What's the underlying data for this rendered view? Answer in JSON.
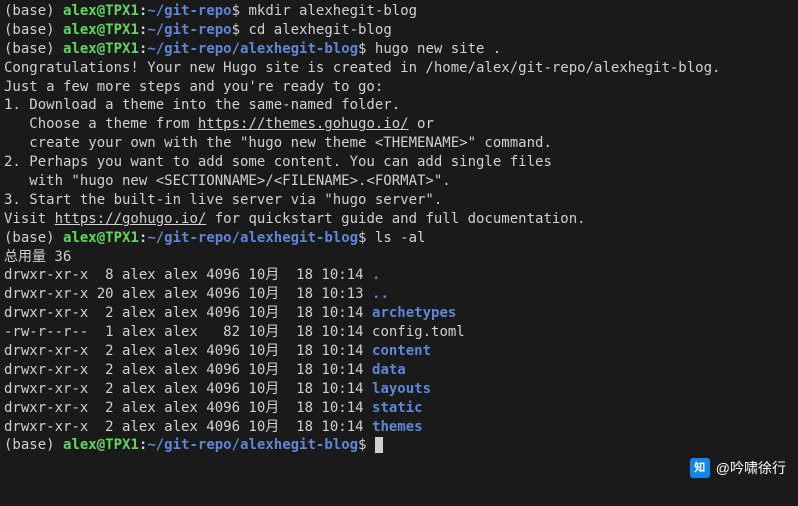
{
  "prompts": [
    {
      "env": "(base) ",
      "user": "alex",
      "at": "@",
      "host": "TPX1",
      "colon": ":",
      "path": "~/git-repo",
      "symbol": "$ ",
      "command": "mkdir alexhegit-blog"
    },
    {
      "env": "(base) ",
      "user": "alex",
      "at": "@",
      "host": "TPX1",
      "colon": ":",
      "path": "~/git-repo",
      "symbol": "$ ",
      "command": "cd alexhegit-blog"
    },
    {
      "env": "(base) ",
      "user": "alex",
      "at": "@",
      "host": "TPX1",
      "colon": ":",
      "path": "~/git-repo/alexhegit-blog",
      "symbol": "$ ",
      "command": "hugo new site ."
    }
  ],
  "congrats": "Congratulations! Your new Hugo site is created in /home/alex/git-repo/alexhegit-blog.",
  "blank1": "",
  "ready": "Just a few more steps and you're ready to go:",
  "blank2": "",
  "step1a": "1. Download a theme into the same-named folder.",
  "step1b_pre": "   Choose a theme from ",
  "step1b_link": "https://themes.gohugo.io/",
  "step1b_post": " or",
  "step1c": "   create your own with the \"hugo new theme <THEMENAME>\" command.",
  "step2a": "2. Perhaps you want to add some content. You can add single files",
  "step2b": "   with \"hugo new <SECTIONNAME>/<FILENAME>.<FORMAT>\".",
  "step3": "3. Start the built-in live server via \"hugo server\".",
  "blank3": "",
  "visit_pre": "Visit ",
  "visit_link": "https://gohugo.io/",
  "visit_post": " for quickstart guide and full documentation.",
  "prompt_ls": {
    "env": "(base) ",
    "user": "alex",
    "at": "@",
    "host": "TPX1",
    "colon": ":",
    "path": "~/git-repo/alexhegit-blog",
    "symbol": "$ ",
    "command": "ls -al"
  },
  "total": "总用量 36",
  "ls": [
    {
      "perms": "drwxr-xr-x  8 alex alex 4096 10月  18 10:14 ",
      "name": ".",
      "is_dir": true
    },
    {
      "perms": "drwxr-xr-x 20 alex alex 4096 10月  18 10:13 ",
      "name": "..",
      "is_dir": true
    },
    {
      "perms": "drwxr-xr-x  2 alex alex 4096 10月  18 10:14 ",
      "name": "archetypes",
      "is_dir": true
    },
    {
      "perms": "-rw-r--r--  1 alex alex   82 10月  18 10:14 ",
      "name": "config.toml",
      "is_dir": false
    },
    {
      "perms": "drwxr-xr-x  2 alex alex 4096 10月  18 10:14 ",
      "name": "content",
      "is_dir": true
    },
    {
      "perms": "drwxr-xr-x  2 alex alex 4096 10月  18 10:14 ",
      "name": "data",
      "is_dir": true
    },
    {
      "perms": "drwxr-xr-x  2 alex alex 4096 10月  18 10:14 ",
      "name": "layouts",
      "is_dir": true
    },
    {
      "perms": "drwxr-xr-x  2 alex alex 4096 10月  18 10:14 ",
      "name": "static",
      "is_dir": true
    },
    {
      "perms": "drwxr-xr-x  2 alex alex 4096 10月  18 10:14 ",
      "name": "themes",
      "is_dir": true
    }
  ],
  "prompt_final": {
    "env": "(base) ",
    "user": "alex",
    "at": "@",
    "host": "TPX1",
    "colon": ":",
    "path": "~/git-repo/alexhegit-blog",
    "symbol": "$ "
  },
  "watermark": {
    "zhihu": "知",
    "at": "@吟啸徐行"
  }
}
